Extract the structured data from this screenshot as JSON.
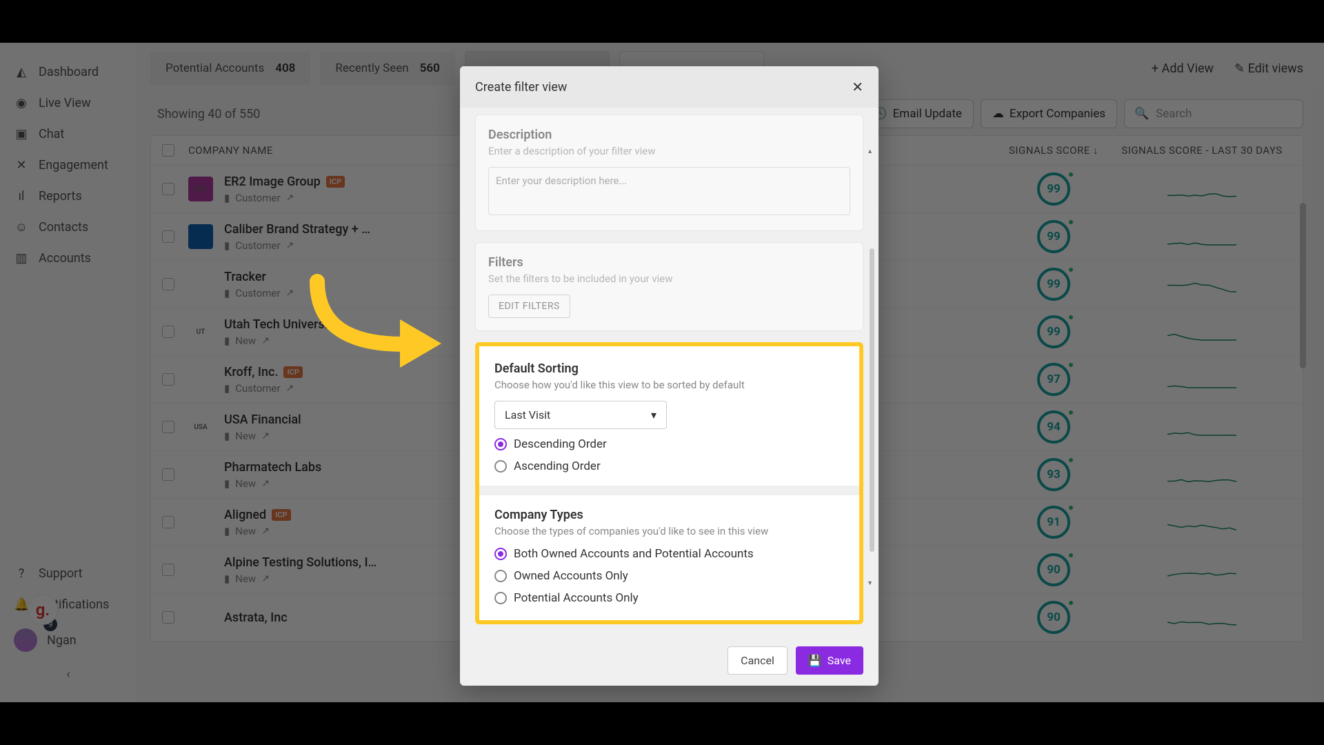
{
  "sidebar": {
    "items": [
      {
        "label": "Dashboard",
        "icon": "◭"
      },
      {
        "label": "Live View",
        "icon": "◉"
      },
      {
        "label": "Chat",
        "icon": "▣"
      },
      {
        "label": "Engagement",
        "icon": "✕"
      },
      {
        "label": "Reports",
        "icon": "ıl"
      },
      {
        "label": "Contacts",
        "icon": "☺"
      },
      {
        "label": "Accounts",
        "icon": "▥"
      }
    ],
    "footer": {
      "support": "Support",
      "notifications": "Notifications",
      "user": "Ngan",
      "badge_count": "9",
      "g_badge": "g."
    }
  },
  "tabs": [
    {
      "label": "Potential Accounts",
      "count": "408"
    },
    {
      "label": "Recently Seen",
      "count": "560"
    }
  ],
  "tabs_actions": {
    "add_view": "+ Add View",
    "edit_views": "Edit views",
    "edit_icon": "✎"
  },
  "listing": {
    "showing": "Showing 40 of  550",
    "email_update_btn": "Email Update",
    "export_btn": "Export Companies",
    "search_placeholder": "Search"
  },
  "table": {
    "headers": {
      "company": "COMPANY NAME",
      "score": "SIGNALS SCORE",
      "score30": "SIGNALS SCORE - LAST 30 DAYS"
    },
    "rows": [
      {
        "name": "ER2 Image Group",
        "icp": true,
        "sub": "Customer",
        "score": "99",
        "logo_bg": "#b03aa0",
        "logo_text": "ER2"
      },
      {
        "name": "Caliber Brand Strategy + …",
        "icp": false,
        "sub": "Customer",
        "score": "99",
        "logo_bg": "#0f62b0",
        "logo_text": ""
      },
      {
        "name": "Tracker",
        "icp": false,
        "sub": "Customer",
        "score": "99",
        "logo_bg": "#fff",
        "logo_text": ""
      },
      {
        "name": "Utah Tech University",
        "icp": false,
        "sub": "New",
        "score": "99",
        "logo_bg": "#fff",
        "logo_text": "UT"
      },
      {
        "name": "Kroff, Inc.",
        "icp": true,
        "sub": "Customer",
        "score": "97",
        "logo_bg": "#fff",
        "logo_text": ""
      },
      {
        "name": "USA Financial",
        "icp": false,
        "sub": "New",
        "score": "94",
        "logo_bg": "#fff",
        "logo_text": "USA"
      },
      {
        "name": "Pharmatech Labs",
        "icp": false,
        "sub": "New",
        "score": "93",
        "logo_bg": "#fff",
        "logo_text": ""
      },
      {
        "name": "Aligned",
        "icp": true,
        "sub": "New",
        "score": "91",
        "logo_bg": "#fff",
        "logo_text": ""
      },
      {
        "name": "Alpine Testing Solutions, I…",
        "icp": false,
        "sub": "New",
        "score": "90",
        "logo_bg": "#fff",
        "logo_text": ""
      },
      {
        "name": "Astrata, Inc",
        "icp": false,
        "sub": "",
        "score": "90",
        "logo_bg": "#fff",
        "logo_text": ""
      }
    ]
  },
  "modal": {
    "title": "Create filter view",
    "description": {
      "heading": "Description",
      "hint": "Enter a description of your filter view",
      "placeholder": "Enter your description here..."
    },
    "filters": {
      "heading": "Filters",
      "hint": "Set the filters to be included in your view",
      "button": "EDIT FILTERS"
    },
    "sorting": {
      "heading": "Default Sorting",
      "hint": "Choose how you'd like this view to be sorted by default",
      "select_value": "Last Visit",
      "opt_desc": "Descending Order",
      "opt_asc": "Ascending Order"
    },
    "company_types": {
      "heading": "Company Types",
      "hint": "Choose the types of companies you'd like to see in this view",
      "opt_both": "Both Owned Accounts and Potential Accounts",
      "opt_owned": "Owned Accounts Only",
      "opt_potential": "Potential Accounts Only"
    },
    "cancel": "Cancel",
    "save": "Save"
  }
}
